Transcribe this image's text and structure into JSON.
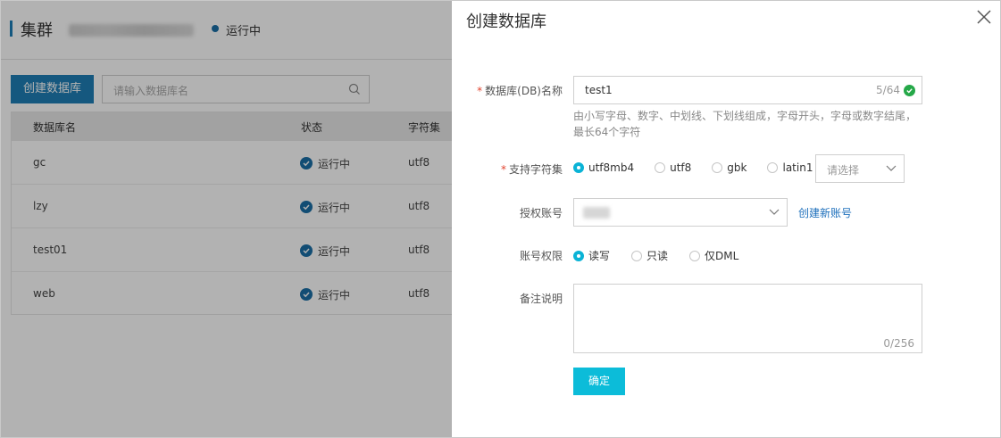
{
  "background": {
    "title": "集群",
    "status": "运行中",
    "create_button": "创建数据库",
    "search_placeholder": "请输入数据库名",
    "table": {
      "headers": [
        "数据库名",
        "状态",
        "字符集"
      ],
      "rows": [
        {
          "name": "gc",
          "status": "运行中",
          "charset": "utf8"
        },
        {
          "name": "lzy",
          "status": "运行中",
          "charset": "utf8"
        },
        {
          "name": "test01",
          "status": "运行中",
          "charset": "utf8"
        },
        {
          "name": "web",
          "status": "运行中",
          "charset": "utf8"
        }
      ]
    }
  },
  "drawer": {
    "title": "创建数据库",
    "db_name": {
      "required_mark": "*",
      "label": "数据库(DB)名称",
      "value": "test1",
      "counter": "5/64",
      "hint_line1": "由小写字母、数字、中划线、下划线组成，字母开头，字母或数字结尾，",
      "hint_line2": "最长64个字符"
    },
    "charset": {
      "required_mark": "*",
      "label": "支持字符集",
      "options": [
        "utf8mb4",
        "utf8",
        "gbk",
        "latin1"
      ],
      "selected": "utf8mb4",
      "select_placeholder": "请选择"
    },
    "account": {
      "label": "授权账号",
      "create_link": "创建新账号"
    },
    "permission": {
      "label": "账号权限",
      "options": [
        "读写",
        "只读",
        "仅DML"
      ],
      "selected": "读写"
    },
    "remark": {
      "label": "备注说明",
      "counter": "0/256"
    },
    "confirm_button": "确定"
  },
  "colors": {
    "accent": "#0cbcd9",
    "primary_blue": "#1f7fb6",
    "success_green": "#25a848",
    "required_red": "#e2442f",
    "link": "#1d6fbb"
  }
}
